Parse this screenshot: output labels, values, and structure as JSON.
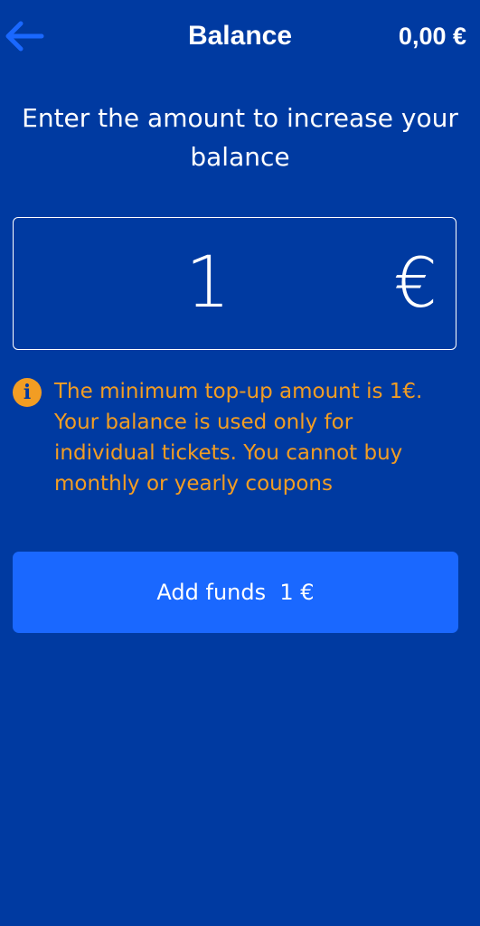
{
  "header": {
    "back_icon": "arrow-left-icon",
    "title": "Balance",
    "balance": "0,00 €"
  },
  "prompt": "Enter the amount to increase your balance",
  "amount": {
    "value": "1",
    "currency": "€"
  },
  "info": {
    "icon": "info-icon",
    "text": "The minimum top-up amount is 1€. Your balance is used only for individual tickets. You cannot buy monthly or yearly coupons"
  },
  "add_button": {
    "label": "Add funds  1 €"
  },
  "colors": {
    "background": "#003aa1",
    "button": "#1a68ff",
    "info": "#f29d23",
    "back_arrow": "#1a68ff"
  }
}
